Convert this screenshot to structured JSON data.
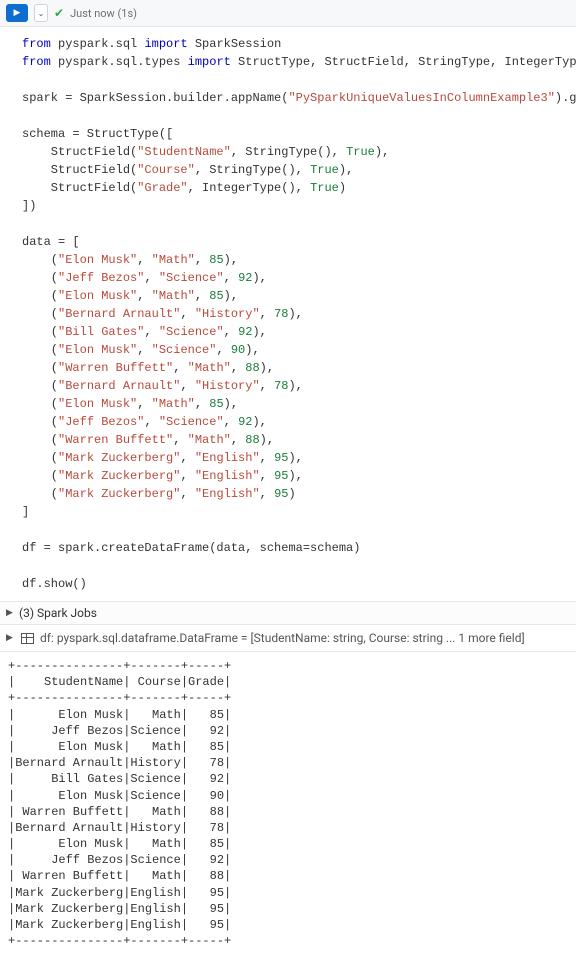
{
  "header": {
    "runtime_label": "Just now (1s)"
  },
  "code": {
    "from1_a": "from",
    "from1_b": " pyspark.sql ",
    "from1_c": "import",
    "from1_d": " SparkSession",
    "from2_a": "from",
    "from2_b": " pyspark.sql.types ",
    "from2_c": "import",
    "from2_d": " StructType, StructField, StringType, IntegerType",
    "spark_a": "spark = SparkSession.builder.appName(",
    "spark_str": "\"PySparkUniqueValuesInColumnExample3\"",
    "spark_b": ").getOrCreate()",
    "schema_a": "schema = StructType([",
    "sf_open": "    StructField(",
    "sf1_name": "\"StudentName\"",
    "sf_sep": ", ",
    "sf1_type": "StringType()",
    "sf_true": "True",
    "sf_close": "),",
    "sf2_name": "\"Course\"",
    "sf2_type": "StringType()",
    "sf3_name": "\"Grade\"",
    "sf3_type": "IntegerType()",
    "sf3_close": ")",
    "schema_close": "])",
    "data_a": "data = [",
    "row_open": "    (",
    "comma": ", ",
    "row_close": "),",
    "row_close_last": ")",
    "rows": [
      {
        "n": "\"Elon Musk\"",
        "c": "\"Math\"",
        "g": "85"
      },
      {
        "n": "\"Jeff Bezos\"",
        "c": "\"Science\"",
        "g": "92"
      },
      {
        "n": "\"Elon Musk\"",
        "c": "\"Math\"",
        "g": "85"
      },
      {
        "n": "\"Bernard Arnault\"",
        "c": "\"History\"",
        "g": "78"
      },
      {
        "n": "\"Bill Gates\"",
        "c": "\"Science\"",
        "g": "92"
      },
      {
        "n": "\"Elon Musk\"",
        "c": "\"Science\"",
        "g": "90"
      },
      {
        "n": "\"Warren Buffett\"",
        "c": "\"Math\"",
        "g": "88"
      },
      {
        "n": "\"Bernard Arnault\"",
        "c": "\"History\"",
        "g": "78"
      },
      {
        "n": "\"Elon Musk\"",
        "c": "\"Math\"",
        "g": "85"
      },
      {
        "n": "\"Jeff Bezos\"",
        "c": "\"Science\"",
        "g": "92"
      },
      {
        "n": "\"Warren Buffett\"",
        "c": "\"Math\"",
        "g": "88"
      },
      {
        "n": "\"Mark Zuckerberg\"",
        "c": "\"English\"",
        "g": "95"
      },
      {
        "n": "\"Mark Zuckerberg\"",
        "c": "\"English\"",
        "g": "95"
      },
      {
        "n": "\"Mark Zuckerberg\"",
        "c": "\"English\"",
        "g": "95"
      }
    ],
    "data_close": "]",
    "df_a": "df = spark.createDataFrame(data, schema=schema)",
    "show_a": "df.show()"
  },
  "output": {
    "jobs_label": "(3) Spark Jobs",
    "schema_label": "df:  pyspark.sql.dataframe.DataFrame = [StudentName: string, Course: string ... 1 more field]",
    "sep": "+---------------+-------+-----+",
    "header": "|    StudentName| Course|Grade|",
    "rows": [
      "|      Elon Musk|   Math|   85|",
      "|     Jeff Bezos|Science|   92|",
      "|      Elon Musk|   Math|   85|",
      "|Bernard Arnault|History|   78|",
      "|     Bill Gates|Science|   92|",
      "|      Elon Musk|Science|   90|",
      "| Warren Buffett|   Math|   88|",
      "|Bernard Arnault|History|   78|",
      "|      Elon Musk|   Math|   85|",
      "|     Jeff Bezos|Science|   92|",
      "| Warren Buffett|   Math|   88|",
      "|Mark Zuckerberg|English|   95|",
      "|Mark Zuckerberg|English|   95|",
      "|Mark Zuckerberg|English|   95|"
    ]
  }
}
